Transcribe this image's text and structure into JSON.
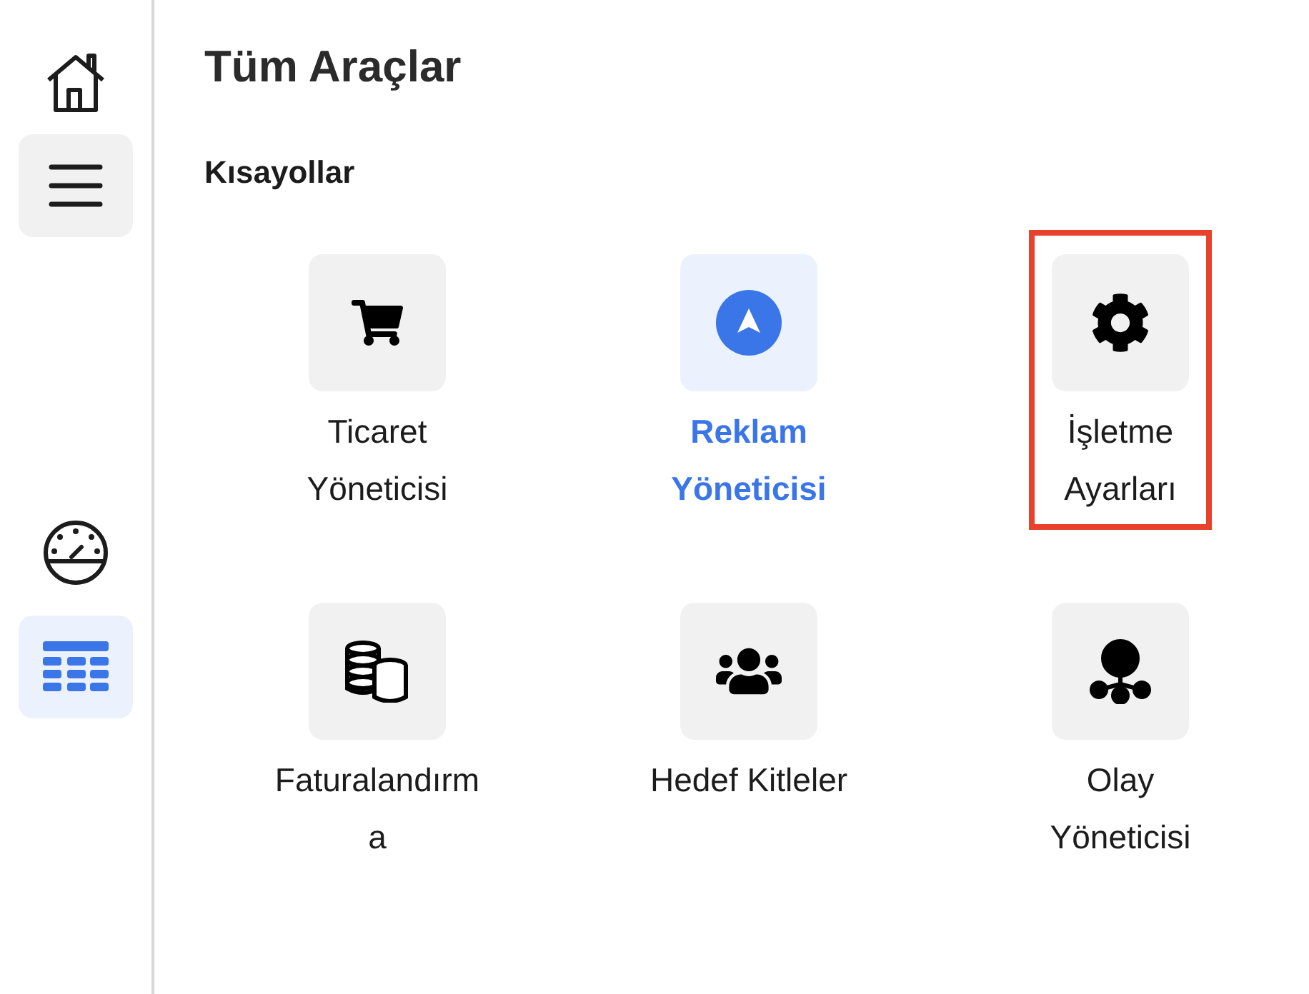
{
  "sidebar": {
    "items": [
      {
        "selected": false,
        "shaded": false
      },
      {
        "selected": false,
        "shaded": true
      },
      {
        "selected": false,
        "shaded": false
      },
      {
        "selected": true,
        "shaded": false
      }
    ]
  },
  "title": "Tüm Araçlar",
  "section": {
    "title": "Kısayollar",
    "tools": [
      {
        "lines": [
          "Ticaret",
          "Yöneticisi"
        ],
        "selected": false,
        "highlighted": false
      },
      {
        "lines": [
          "Reklam",
          "Yöneticisi"
        ],
        "selected": true,
        "highlighted": false
      },
      {
        "lines": [
          "İşletme",
          "Ayarları"
        ],
        "selected": false,
        "highlighted": true
      },
      {
        "lines": [
          "Faturalandırm",
          "a"
        ],
        "selected": false,
        "highlighted": false
      },
      {
        "lines": [
          "Hedef Kitleler"
        ],
        "selected": false,
        "highlighted": false
      },
      {
        "lines": [
          "Olay",
          "Yöneticisi"
        ],
        "selected": false,
        "highlighted": false
      }
    ]
  }
}
